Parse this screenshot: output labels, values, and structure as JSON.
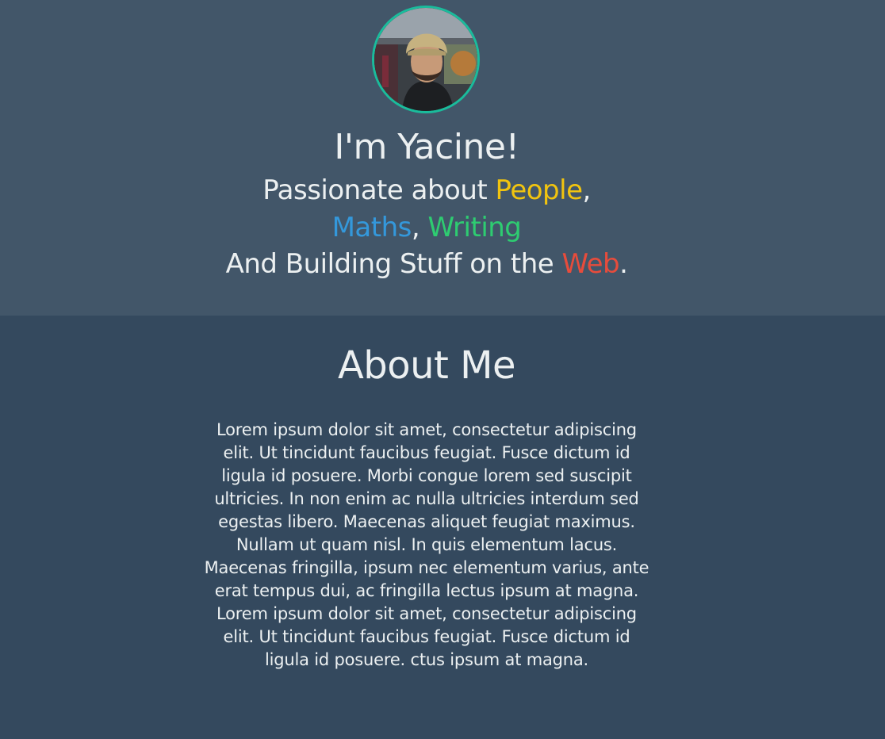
{
  "hero": {
    "title": "I'm Yacine!",
    "line1_prefix": "Passionate about ",
    "line1_highlight": "People",
    "line1_suffix": ",",
    "line2_word1": "Maths",
    "line2_sep": ", ",
    "line2_word2": "Writing",
    "line3_prefix": "And Building Stuff on the ",
    "line3_highlight": "Web",
    "line3_suffix": ".",
    "avatar_icon": "profile-photo"
  },
  "about": {
    "title": "About Me",
    "body": "Lorem ipsum dolor sit amet, consectetur adipiscing elit. Ut tincidunt faucibus feugiat. Fusce dictum id ligula id posuere. Morbi congue lorem sed suscipit ultricies. In non enim ac nulla ultricies interdum sed egestas libero. Maecenas aliquet feugiat maximus. Nullam ut quam nisl. In quis elementum lacus. Maecenas fringilla, ipsum nec elementum varius, ante erat tempus dui, ac fringilla lectus ipsum at magna. Lorem ipsum dolor sit amet, consectetur adipiscing elit. Ut tincidunt faucibus feugiat. Fusce dictum id ligula id posuere. ctus ipsum at magna."
  },
  "colors": {
    "hero_bg": "#425669",
    "about_bg": "#34495e",
    "accent_people": "#f1c40f",
    "accent_maths": "#3498db",
    "accent_writing": "#2ecc71",
    "accent_web": "#e74c3c",
    "avatar_border": "#1abc9c"
  }
}
